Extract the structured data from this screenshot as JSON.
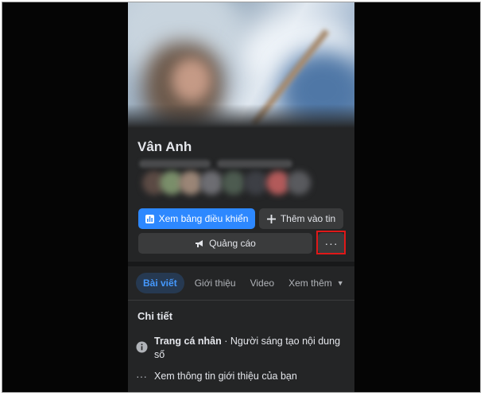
{
  "profile": {
    "name": "Vân Anh"
  },
  "actions": {
    "dashboard_label": "Xem bảng điều khiển",
    "add_story_label": "Thêm vào tin",
    "ads_label": "Quảng cáo",
    "more_label": "···"
  },
  "tabs": [
    {
      "label": "Bài viết",
      "active": true
    },
    {
      "label": "Giới thiệu"
    },
    {
      "label": "Video"
    },
    {
      "label": "Xem thêm"
    }
  ],
  "details": {
    "title": "Chi tiết",
    "profile_type_label": "Trang cá nhân",
    "profile_type_value": " · Người sáng tạo nội dung số",
    "intro_link": "Xem thông tin giới thiệu của bạn"
  },
  "colors": {
    "primary": "#2d88ff",
    "highlight_box": "#e01818",
    "background": "#242526"
  },
  "icons": {
    "dashboard": "bar-chart-icon",
    "add": "plus-icon",
    "ads": "megaphone-icon",
    "info": "info-icon",
    "more": "dots-icon",
    "caret": "caret-down-icon"
  }
}
